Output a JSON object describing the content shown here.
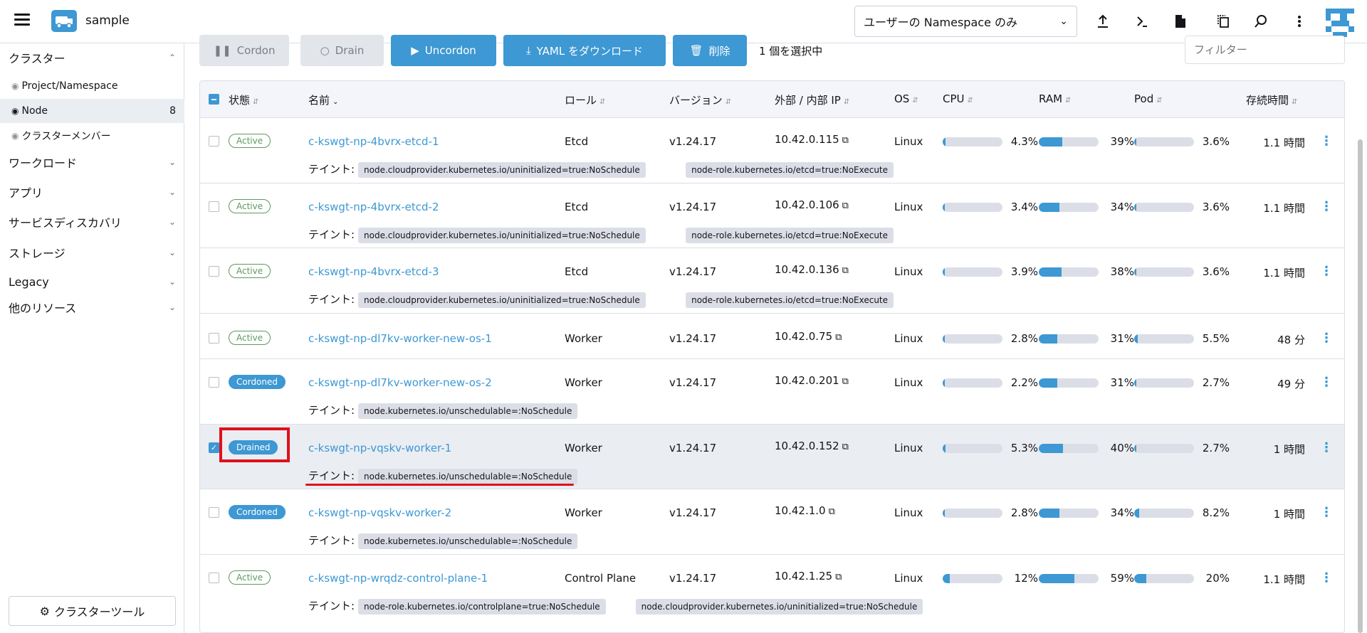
{
  "header": {
    "app_name": "sample",
    "namespace_filter": "ユーザーの Namespace のみ"
  },
  "sidebar": {
    "groups": [
      {
        "label": "クラスター",
        "expanded": true
      },
      {
        "label": "ワークロード"
      },
      {
        "label": "アプリ"
      },
      {
        "label": "サービスディスカバリ"
      },
      {
        "label": "ストレージ"
      },
      {
        "label": "Legacy"
      },
      {
        "label": "他のリソース"
      }
    ],
    "cluster_items": [
      {
        "label": "Project/Namespace"
      },
      {
        "label": "Node",
        "count": "8",
        "active": true
      },
      {
        "label": "クラスターメンバー"
      }
    ],
    "tools_button": "クラスターツール"
  },
  "toolbar": {
    "cordon": "Cordon",
    "drain": "Drain",
    "uncordon": "Uncordon",
    "download_yaml": "YAML をダウンロード",
    "delete": "削除",
    "selection_count": "1 個を選択中",
    "filter_placeholder": "フィルター"
  },
  "table": {
    "columns": [
      "状態",
      "名前",
      "ロール",
      "バージョン",
      "外部 / 内部 IP",
      "OS",
      "CPU",
      "RAM",
      "Pod",
      "存続時間"
    ],
    "taint_label": "テイント:",
    "rows": [
      {
        "state": "Active",
        "name": "c-kswgt-np-4bvrx-etcd-1",
        "role": "Etcd",
        "version": "v1.24.17",
        "ip": "10.42.0.115",
        "os": "Linux",
        "cpu": "4.3%",
        "ram": "39%",
        "pod": "3.6%",
        "age": "1.1 時間",
        "taints": [
          "node.cloudprovider.kubernetes.io/uninitialized=true:NoSchedule",
          "node-role.kubernetes.io/etcd=true:NoExecute"
        ]
      },
      {
        "state": "Active",
        "name": "c-kswgt-np-4bvrx-etcd-2",
        "role": "Etcd",
        "version": "v1.24.17",
        "ip": "10.42.0.106",
        "os": "Linux",
        "cpu": "3.4%",
        "ram": "34%",
        "pod": "3.6%",
        "age": "1.1 時間",
        "taints": [
          "node.cloudprovider.kubernetes.io/uninitialized=true:NoSchedule",
          "node-role.kubernetes.io/etcd=true:NoExecute"
        ]
      },
      {
        "state": "Active",
        "name": "c-kswgt-np-4bvrx-etcd-3",
        "role": "Etcd",
        "version": "v1.24.17",
        "ip": "10.42.0.136",
        "os": "Linux",
        "cpu": "3.9%",
        "ram": "38%",
        "pod": "3.6%",
        "age": "1.1 時間",
        "taints": [
          "node.cloudprovider.kubernetes.io/uninitialized=true:NoSchedule",
          "node-role.kubernetes.io/etcd=true:NoExecute"
        ]
      },
      {
        "state": "Active",
        "name": "c-kswgt-np-dl7kv-worker-new-os-1",
        "role": "Worker",
        "version": "v1.24.17",
        "ip": "10.42.0.75",
        "os": "Linux",
        "cpu": "2.8%",
        "ram": "31%",
        "pod": "5.5%",
        "age": "48 分",
        "taints": []
      },
      {
        "state": "Cordoned",
        "name": "c-kswgt-np-dl7kv-worker-new-os-2",
        "role": "Worker",
        "version": "v1.24.17",
        "ip": "10.42.0.201",
        "os": "Linux",
        "cpu": "2.2%",
        "ram": "31%",
        "pod": "2.7%",
        "age": "49 分",
        "taints": [
          "node.kubernetes.io/unschedulable=:NoSchedule"
        ]
      },
      {
        "state": "Drained",
        "name": "c-kswgt-np-vqskv-worker-1",
        "role": "Worker",
        "version": "v1.24.17",
        "ip": "10.42.0.152",
        "os": "Linux",
        "cpu": "5.3%",
        "ram": "40%",
        "pod": "2.7%",
        "age": "1 時間",
        "selected": true,
        "taints": [
          "node.kubernetes.io/unschedulable=:NoSchedule"
        ]
      },
      {
        "state": "Cordoned",
        "name": "c-kswgt-np-vqskv-worker-2",
        "role": "Worker",
        "version": "v1.24.17",
        "ip": "10.42.1.0",
        "os": "Linux",
        "cpu": "2.8%",
        "ram": "34%",
        "pod": "8.2%",
        "age": "1 時間",
        "taints": [
          "node.kubernetes.io/unschedulable=:NoSchedule"
        ]
      },
      {
        "state": "Active",
        "name": "c-kswgt-np-wrqdz-control-plane-1",
        "role": "Control Plane",
        "version": "v1.24.17",
        "ip": "10.42.1.25",
        "os": "Linux",
        "cpu": "12%",
        "ram": "59%",
        "pod": "20%",
        "age": "1.1 時間",
        "taints": [
          "node-role.kubernetes.io/controlplane=true:NoSchedule",
          "node.cloudprovider.kubernetes.io/uninitialized=true:NoSchedule"
        ]
      }
    ]
  },
  "colors": {
    "accent": "#3d98d3",
    "active": "#5d995d",
    "highlight": "#e0101a"
  }
}
